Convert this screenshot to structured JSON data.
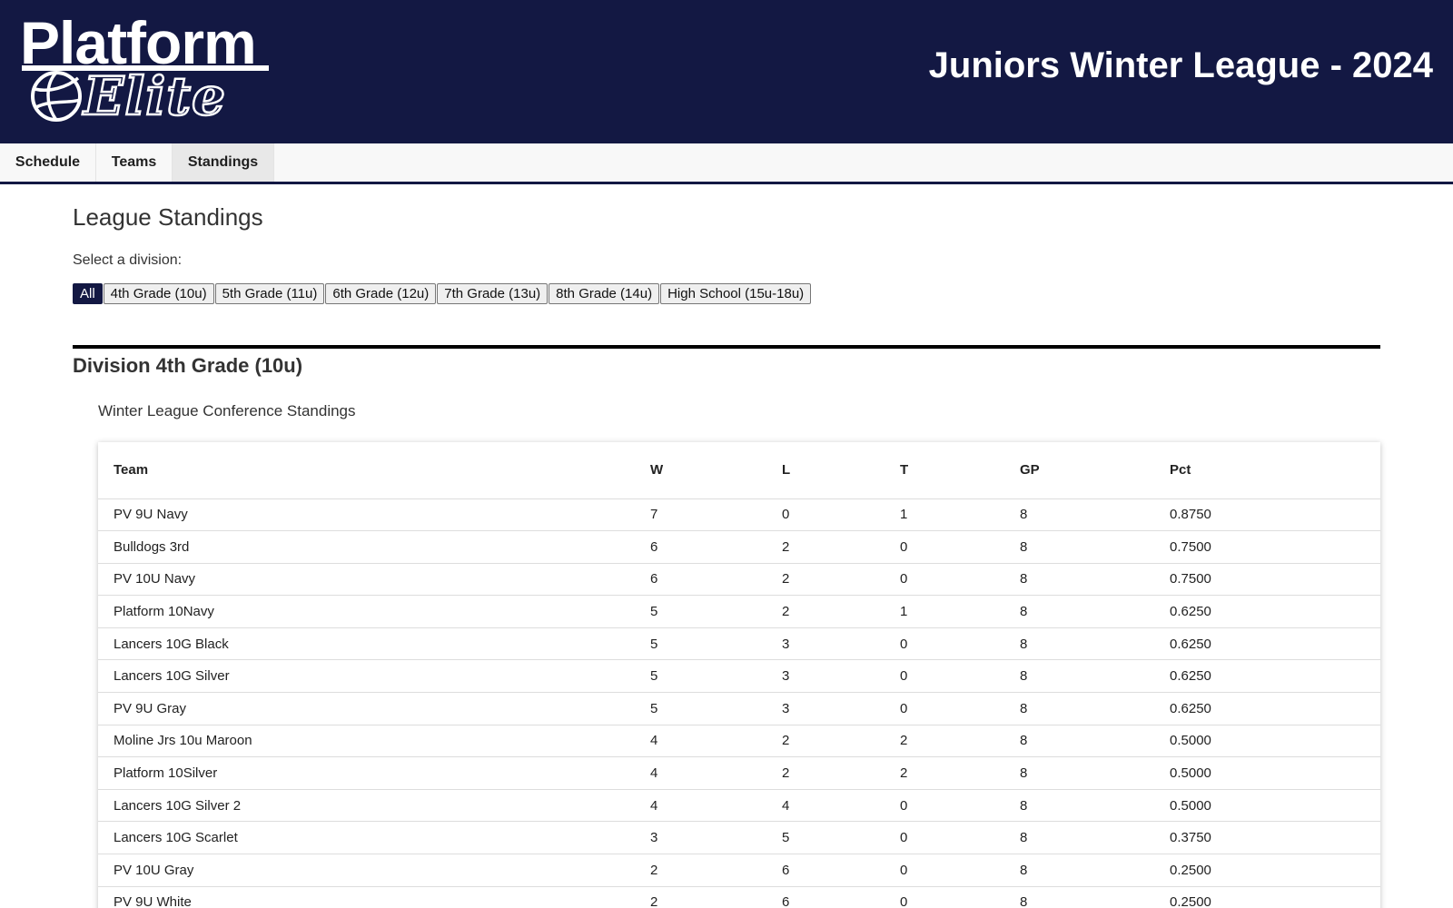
{
  "header": {
    "logo": {
      "line1": "Platform",
      "line2": "Elite"
    },
    "site_title": "Juniors Winter League - 2024"
  },
  "nav": {
    "items": [
      {
        "label": "Schedule",
        "active": false
      },
      {
        "label": "Teams",
        "active": false
      },
      {
        "label": "Standings",
        "active": true
      }
    ]
  },
  "main": {
    "title": "League Standings",
    "select_label": "Select a division:",
    "divisions": [
      {
        "label": "All",
        "active": true
      },
      {
        "label": "4th Grade (10u)",
        "active": false
      },
      {
        "label": "5th Grade (11u)",
        "active": false
      },
      {
        "label": "6th Grade (12u)",
        "active": false
      },
      {
        "label": "7th Grade (13u)",
        "active": false
      },
      {
        "label": "8th Grade (14u)",
        "active": false
      },
      {
        "label": "High School (15u-18u)",
        "active": false
      }
    ],
    "division_title": "Division 4th Grade (10u)",
    "conference_title": "Winter League Conference Standings",
    "table": {
      "columns": [
        "Team",
        "W",
        "L",
        "T",
        "GP",
        "Pct"
      ],
      "rows": [
        [
          "PV 9U Navy",
          "7",
          "0",
          "1",
          "8",
          "0.8750"
        ],
        [
          "Bulldogs 3rd",
          "6",
          "2",
          "0",
          "8",
          "0.7500"
        ],
        [
          "PV 10U Navy",
          "6",
          "2",
          "0",
          "8",
          "0.7500"
        ],
        [
          "Platform 10Navy",
          "5",
          "2",
          "1",
          "8",
          "0.6250"
        ],
        [
          "Lancers 10G Black",
          "5",
          "3",
          "0",
          "8",
          "0.6250"
        ],
        [
          "Lancers 10G Silver",
          "5",
          "3",
          "0",
          "8",
          "0.6250"
        ],
        [
          "PV 9U Gray",
          "5",
          "3",
          "0",
          "8",
          "0.6250"
        ],
        [
          "Moline Jrs 10u Maroon",
          "4",
          "2",
          "2",
          "8",
          "0.5000"
        ],
        [
          "Platform 10Silver",
          "4",
          "2",
          "2",
          "8",
          "0.5000"
        ],
        [
          "Lancers 10G Silver 2",
          "4",
          "4",
          "0",
          "8",
          "0.5000"
        ],
        [
          "Lancers 10G Scarlet",
          "3",
          "5",
          "0",
          "8",
          "0.3750"
        ],
        [
          "PV 10U Gray",
          "2",
          "6",
          "0",
          "8",
          "0.2500"
        ],
        [
          "PV 9U White",
          "2",
          "6",
          "0",
          "8",
          "0.2500"
        ]
      ]
    }
  },
  "colors": {
    "header_bg": "#131843",
    "active_filter_bg": "#131843",
    "nav_active_bg": "#e8e8e8"
  }
}
